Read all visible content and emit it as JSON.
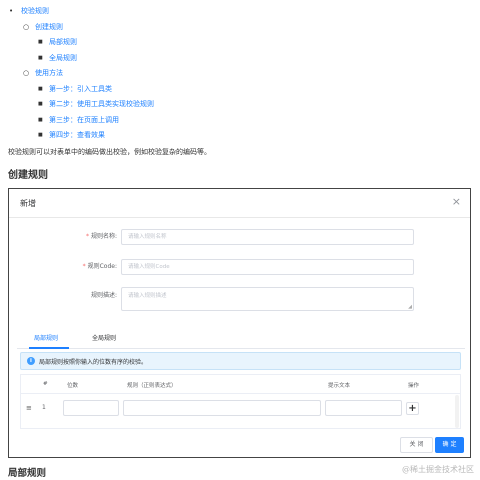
{
  "toc": {
    "root": "校验规则",
    "create": "创建规则",
    "create_items": [
      "局部规则",
      "全局规则"
    ],
    "usage": "使用方法",
    "usage_items": [
      "第一步：引入工具类",
      "第二步：使用工具类实现校验规则",
      "第三步：在页面上调用",
      "第四步：查看效果"
    ]
  },
  "description": "校验规则可以对表单中的编码做出校验，例如校验复杂的编码等。",
  "section_heading": "创建规则",
  "modal": {
    "title": "新增",
    "close_icon": "×",
    "fields": {
      "name": {
        "label": "规则名称:",
        "placeholder": "请输入规则名称"
      },
      "code": {
        "label": "规则Code:",
        "placeholder": "请输入规则Code"
      },
      "description": {
        "label": "规则描述:",
        "placeholder": "请输入规则描述"
      }
    },
    "tabs": [
      "局部规则",
      "全局规则"
    ],
    "alert_text": "局部规则按照你输入的位数有序的校验。",
    "table": {
      "headers": [
        "#",
        "位数",
        "规则（正则表达式）",
        "提示文本",
        "操作"
      ],
      "rows": [
        {
          "index": "1"
        }
      ],
      "add_symbol": "+",
      "drag_symbol": "≡"
    },
    "buttons": {
      "cancel": "关 闭",
      "confirm": "确 定"
    }
  },
  "bottom_heading": "局部规则",
  "watermark": "@稀土掘金技术社区",
  "colors": {
    "link": "#1e80ff",
    "required": "#f56c6c",
    "alert_bg": "#e8f4fd",
    "primary_button": "#1e80ff"
  }
}
